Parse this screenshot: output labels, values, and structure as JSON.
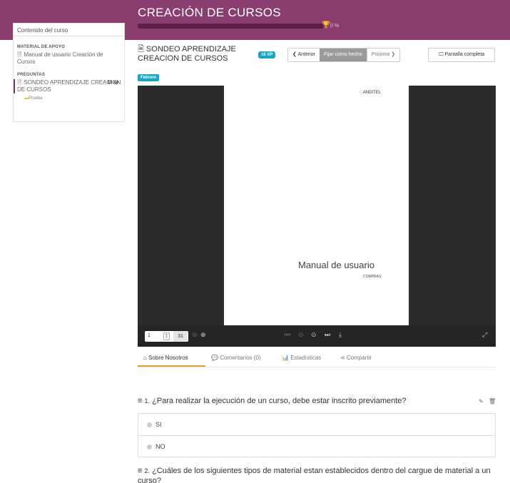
{
  "course": {
    "title": "CREACIÓN DE CURSOS",
    "progress_pct": 0,
    "progress_label": "0 %"
  },
  "sidebar": {
    "heading": "Contenido del curso",
    "sections": [
      {
        "title": "MATERIAL DE APOYO",
        "items": [
          {
            "label": "Manual de usuario Creación de Cursos",
            "icon": "file-pdf-icon"
          }
        ]
      },
      {
        "title": "PREGUNTAS",
        "items": [
          {
            "label": "SONDEO APRENDIZAJE CREACION DE CURSOS",
            "xp": "10 xp",
            "icon": "file-pdf-icon",
            "sub": "Prueba"
          }
        ]
      }
    ]
  },
  "lesson": {
    "title": "SONDEO APRENDIZAJE CREACION DE CURSOS",
    "xp_badge": "10 XP",
    "tag": "Febrero"
  },
  "nav": {
    "prev_label": "Anterior",
    "done_label": "Fijar como hecho",
    "next_label": "Próxima",
    "fullscreen_label": "Pantalla completa"
  },
  "viewer": {
    "logo_text": "ANDITEL",
    "page_title": "Manual de usuario",
    "page_subtitle": "COMPRAS",
    "current_page": "1",
    "total_pages": "31"
  },
  "tabs": [
    {
      "label": "Sobre Nosotros",
      "icon": "home-icon"
    },
    {
      "label": "Comentarios (0)",
      "icon": "comments-icon"
    },
    {
      "label": "Estadísticas",
      "icon": "chart-icon"
    },
    {
      "label": "Compartir",
      "icon": "share-icon"
    }
  ],
  "questions": [
    {
      "number": "1.",
      "text": "¿Para realizar la ejecución de un curso, debe estar inscrito previamente?",
      "options": [
        "SI",
        "NO"
      ]
    },
    {
      "number": "2.",
      "text": "¿Cuáles de los siguientes tipos de material estan establecidos dentro del cargue de material a un curso?"
    }
  ],
  "colors": {
    "header_purple": "#8a3e6f",
    "badge_blue": "#1aa3c9",
    "tab_accent": "#e0a030",
    "viewer_bg": "#2b2c2e"
  }
}
